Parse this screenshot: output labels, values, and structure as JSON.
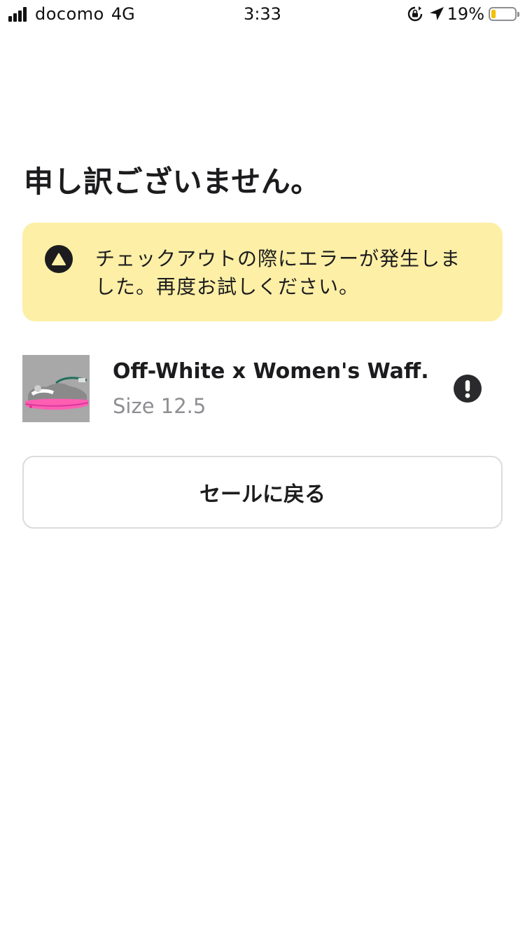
{
  "status_bar": {
    "carrier": "docomo",
    "network": "4G",
    "time": "3:33",
    "battery_percent": "19%",
    "battery_level": 0.19,
    "battery_color": "#f2c200"
  },
  "page": {
    "title": "申し訳ございません。"
  },
  "alert": {
    "message": "チェックアウトの際にエラーが発生しました。再度お試しください。",
    "background": "#fdefa6",
    "icon": "warning-triangle-icon"
  },
  "product": {
    "name": "Off-White x Women's Waff...",
    "size": "Size 12.5",
    "status_icon": "exclamation-icon"
  },
  "actions": {
    "back_to_sale": "セールに戻る"
  }
}
